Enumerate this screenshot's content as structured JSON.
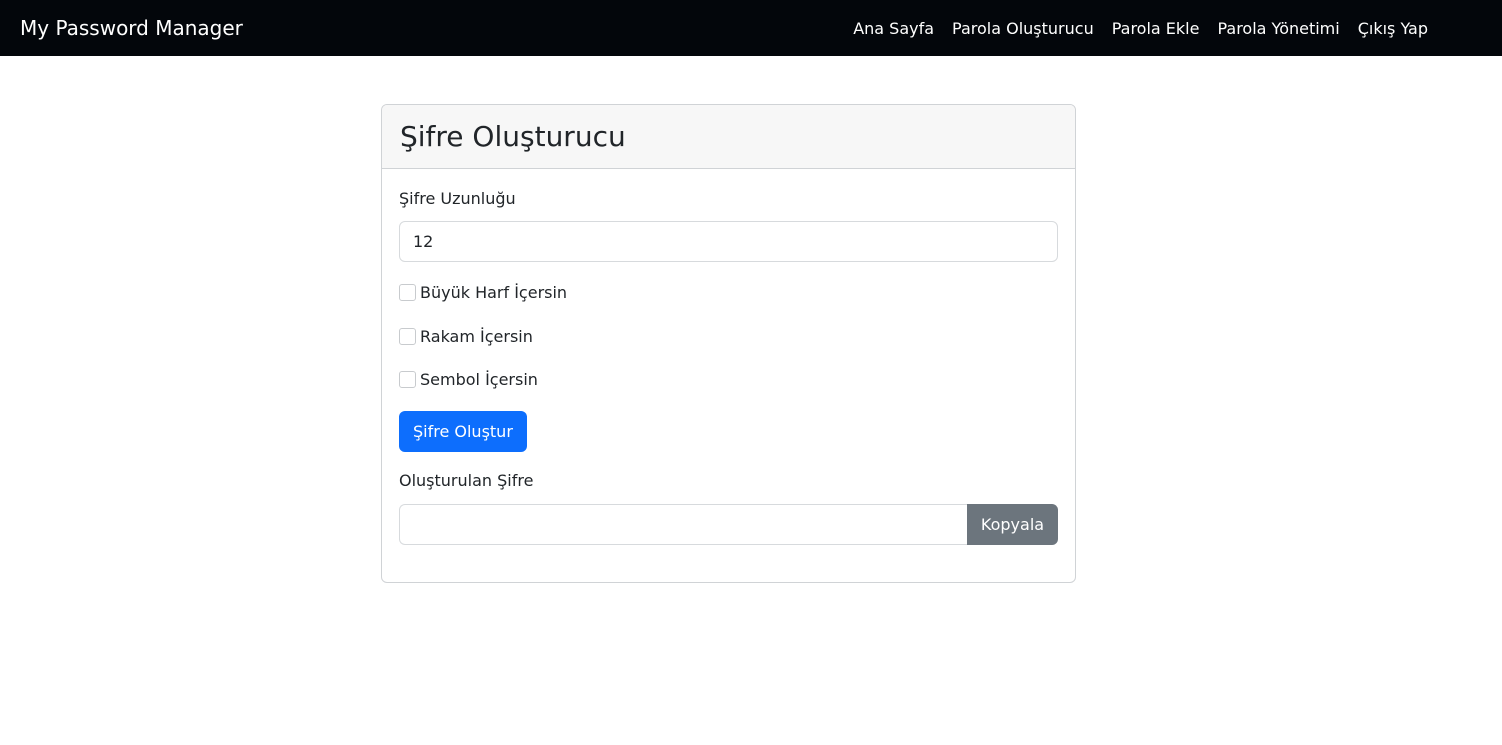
{
  "navbar": {
    "brand": "My Password Manager",
    "links": [
      {
        "label": "Ana Sayfa"
      },
      {
        "label": "Parola Oluşturucu"
      },
      {
        "label": "Parola Ekle"
      },
      {
        "label": "Parola Yönetimi"
      },
      {
        "label": "Çıkış Yap"
      }
    ]
  },
  "card": {
    "title": "Şifre Oluşturucu",
    "length_label": "Şifre Uzunluğu",
    "length_value": "12",
    "options": [
      {
        "label": "Büyük Harf İçersin",
        "checked": false
      },
      {
        "label": "Rakam İçersin",
        "checked": false
      },
      {
        "label": "Sembol İçersin",
        "checked": false
      }
    ],
    "generate_button": "Şifre Oluştur",
    "generated_label": "Oluşturulan Şifre",
    "generated_value": "",
    "copy_button": "Kopyala"
  }
}
